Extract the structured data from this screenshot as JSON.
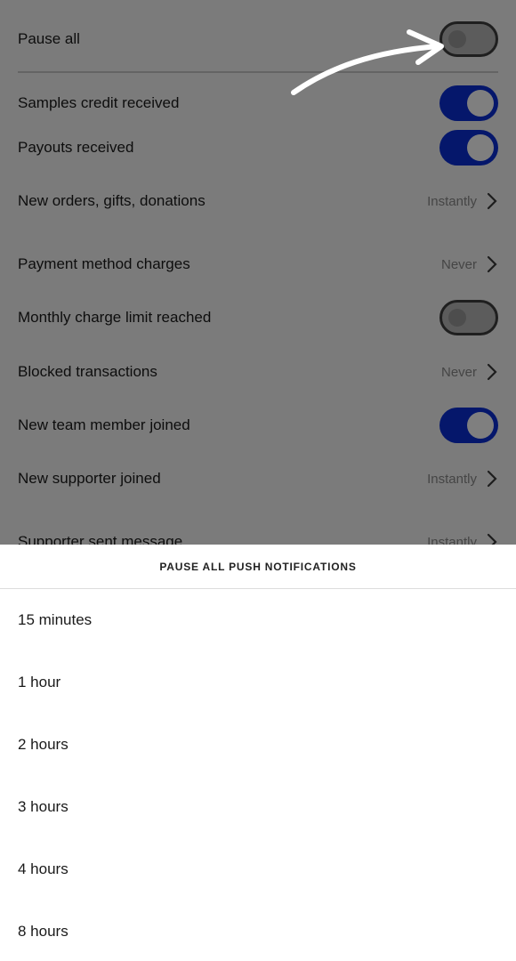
{
  "settings": {
    "pause_all": {
      "label": "Pause all",
      "enabled": false
    },
    "items": [
      {
        "label": "Samples credit received",
        "type": "toggle",
        "enabled": true
      },
      {
        "label": "Payouts received",
        "type": "toggle",
        "enabled": true
      },
      {
        "label": "New orders, gifts, donations",
        "type": "select",
        "value": "Instantly"
      },
      {
        "label": "Payment method charges",
        "type": "select",
        "value": "Never"
      },
      {
        "label": "Monthly charge limit reached",
        "type": "toggle",
        "enabled": false
      },
      {
        "label": "Blocked transactions",
        "type": "select",
        "value": "Never"
      },
      {
        "label": "New team member joined",
        "type": "toggle",
        "enabled": true
      },
      {
        "label": "New supporter joined",
        "type": "select",
        "value": "Instantly"
      },
      {
        "label": "Supporter sent message",
        "type": "select",
        "value": "Instantly"
      }
    ]
  },
  "sheet": {
    "title": "PAUSE ALL PUSH NOTIFICATIONS",
    "options": [
      "15 minutes",
      "1 hour",
      "2 hours",
      "3 hours",
      "4 hours",
      "8 hours"
    ]
  },
  "colors": {
    "toggle_on": "#0a2fd6",
    "toggle_off": "#b8b8b8",
    "overlay": "rgba(0,0,0,0.5)"
  },
  "icons": {
    "chevron": "chevron-right-icon",
    "annotation": "curved-arrow-icon"
  }
}
